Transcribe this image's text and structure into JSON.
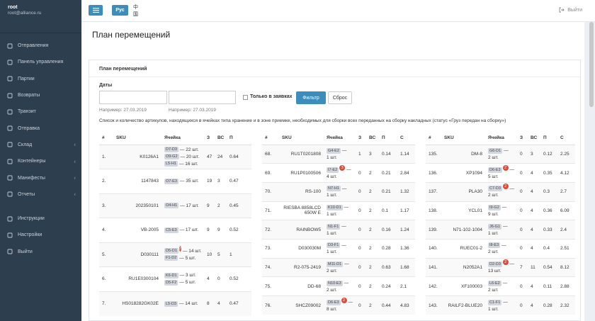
{
  "user": {
    "name": "root",
    "email": "root@alliance.ru"
  },
  "nav": [
    {
      "label": "Отправления",
      "icon": "paper-plane-icon",
      "chev": false
    },
    {
      "label": "Панель управления",
      "icon": "dashboard-icon",
      "chev": false
    },
    {
      "label": "Партии",
      "icon": "truck-icon",
      "chev": false
    },
    {
      "label": "Возвраты",
      "icon": "return-icon",
      "chev": false
    },
    {
      "label": "Транзит",
      "icon": "transit-icon",
      "chev": false
    },
    {
      "label": "Отправка",
      "icon": "send-icon",
      "chev": false
    },
    {
      "label": "Склад",
      "icon": "warehouse-icon",
      "chev": true
    },
    {
      "label": "Контейнеры",
      "icon": "container-icon",
      "chev": true
    },
    {
      "label": "Манифесты",
      "icon": "manifest-icon",
      "chev": true
    },
    {
      "label": "Отчеты",
      "icon": "reports-icon",
      "chev": true
    }
  ],
  "nav2": [
    {
      "label": "Инструкции",
      "icon": "info-icon"
    },
    {
      "label": "Настройки",
      "icon": "settings-icon"
    },
    {
      "label": "Выйти",
      "icon": "logout-icon"
    }
  ],
  "topbar": {
    "lang_ru": "Рус",
    "lang_cn": "中国",
    "logout": "Выйти"
  },
  "page": {
    "title": "План перемещений"
  },
  "box": {
    "title": "План перемещений",
    "dates_label": "Даты",
    "only_requests": "Только в заявках",
    "filter_btn": "Фильтр",
    "reset_btn": "Сброс",
    "hint1": "Например: 27.03.2019",
    "hint2": "Например: 27.03.2019",
    "desc": "Список и количество артикулов, находящихся в ячейках типа хранение и в зоне приемке, необходимых для сборки всех переданных на сборку накладных (статус «Груз передан на сборку»)"
  },
  "colors": {
    "accent": "#3c8dbc",
    "sidebar": "#2d3e4f",
    "badge": "#dd4b39"
  },
  "tables": [
    {
      "headers": [
        "#",
        "SKU",
        "Ячейка",
        "З",
        "ВС",
        "П"
      ],
      "rows": [
        {
          "n": "1.",
          "sku": "K0126A1",
          "cells": [
            {
              "tag": "D7-D3",
              "text": "— 22 шт."
            },
            {
              "tag": "O9-G2",
              "text": "— 20 шт."
            },
            {
              "tag": "L5-H1",
              "text": "— 16 шт."
            }
          ],
          "z": "47",
          "vs": "24",
          "p": "0.64"
        },
        {
          "n": "2.",
          "sku": "1147843",
          "cells": [
            {
              "tag": "O7-E3",
              "text": "— 35 шт."
            }
          ],
          "z": "19",
          "vs": "3",
          "p": "0.47"
        },
        {
          "n": "3.",
          "sku": "202350101",
          "cells": [
            {
              "tag": "O4-H1",
              "text": "— 17 шт."
            }
          ],
          "z": "9",
          "vs": "2",
          "p": "0.45"
        },
        {
          "n": "4.",
          "sku": "VB-2005",
          "cells": [
            {
              "tag": "C5-E3",
              "text": "— 17 шт."
            }
          ],
          "z": "9",
          "vs": "9",
          "p": "0.52"
        },
        {
          "n": "5.",
          "sku": "D030111",
          "cells": [
            {
              "tag": "D5-D1",
              "badge": "2",
              "text": "— 14 шт."
            },
            {
              "tag": "F1-D2",
              "text": "— 5 шт."
            }
          ],
          "z": "10",
          "vs": "5",
          "p": "1"
        },
        {
          "n": "6.",
          "sku": "RU1E0300104",
          "cells": [
            {
              "tag": "K6-D1",
              "text": "— 3 шт."
            },
            {
              "tag": "D5-F2",
              "text": "— 5 шт."
            }
          ],
          "z": "4",
          "vs": "0",
          "p": "0.52"
        },
        {
          "n": "7.",
          "sku": "HS018282GK02E",
          "cells": [
            {
              "tag": "L5-D3",
              "text": "— 14 шт."
            }
          ],
          "z": "8",
          "vs": "4",
          "p": "0.47"
        }
      ]
    },
    {
      "headers": [
        "#",
        "SKU",
        "Ячейка",
        "З",
        "ВС",
        "П",
        "С"
      ],
      "rows": [
        {
          "n": "68.",
          "sku": "RU1T0201808",
          "cells": [
            {
              "tag": "G4-E2",
              "text": "—"
            },
            {
              "text": "1 шт."
            }
          ],
          "z": "1",
          "vs": "3",
          "p": "0.14",
          "s": "1.14"
        },
        {
          "n": "69.",
          "sku": "RU1P0100506",
          "cells": [
            {
              "tag": "I7-E2",
              "badge": "3",
              "text": "—"
            },
            {
              "text": "4 шт."
            }
          ],
          "z": "0",
          "vs": "2",
          "p": "0.21",
          "s": "2.84"
        },
        {
          "n": "70.",
          "sku": "RS-100",
          "cells": [
            {
              "tag": "N7-H1",
              "text": "—"
            },
            {
              "text": "1 шт."
            }
          ],
          "z": "0",
          "vs": "2",
          "p": "0.21",
          "s": "1.32"
        },
        {
          "n": "71.",
          "sku": "RIESBA 8858LCD 650W E",
          "cells": [
            {
              "tag": "K10-D1",
              "text": "—"
            },
            {
              "text": "1 шт."
            }
          ],
          "z": "0",
          "vs": "2",
          "p": "0.1",
          "s": "1.17"
        },
        {
          "n": "72.",
          "sku": "RAINBOW5",
          "cells": [
            {
              "tag": "N1-F1",
              "text": "—"
            },
            {
              "text": "1 шт."
            }
          ],
          "z": "0",
          "vs": "2",
          "p": "0.16",
          "s": "1.24"
        },
        {
          "n": "73.",
          "sku": "D030030M",
          "cells": [
            {
              "tag": "D3-F1",
              "text": "—"
            },
            {
              "text": "1 шт."
            }
          ],
          "z": "0",
          "vs": "2",
          "p": "0.28",
          "s": "1.36"
        },
        {
          "n": "74.",
          "sku": "R2-075-2419",
          "cells": [
            {
              "tag": "M11-D1",
              "text": "—"
            },
            {
              "text": "2 шт."
            }
          ],
          "z": "0",
          "vs": "2",
          "p": "0.63",
          "s": "1.68"
        },
        {
          "n": "75.",
          "sku": "DD-68",
          "cells": [
            {
              "tag": "N10-E3",
              "text": "—"
            },
            {
              "text": "2 шт."
            }
          ],
          "z": "0",
          "vs": "2",
          "p": "0.24",
          "s": "2.1"
        },
        {
          "n": "76.",
          "sku": "SHCZ09002",
          "cells": [
            {
              "tag": "D6-E3",
              "badge": "2",
              "text": "—"
            },
            {
              "text": "8 шт."
            }
          ],
          "z": "0",
          "vs": "2",
          "p": "0.44",
          "s": "4.83"
        }
      ]
    },
    {
      "headers": [
        "#",
        "SKU",
        "Ячейка",
        "З",
        "ВС",
        "П",
        "С"
      ],
      "rows": [
        {
          "n": "135.",
          "sku": "DM-8",
          "cells": [
            {
              "tag": "G6-D1",
              "text": "—"
            },
            {
              "text": "2 шт."
            }
          ],
          "z": "0",
          "vs": "3",
          "p": "0.12",
          "s": "2.25"
        },
        {
          "n": "136.",
          "sku": "XP1094",
          "cells": [
            {
              "tag": "D6-E3",
              "badge": "2",
              "text": "—"
            },
            {
              "text": "5 шт."
            }
          ],
          "z": "0",
          "vs": "4",
          "p": "0.35",
          "s": "4.12"
        },
        {
          "n": "137.",
          "sku": "PLA30",
          "cells": [
            {
              "tag": "C7-D3",
              "badge": "2",
              "text": "—"
            },
            {
              "text": "2 шт."
            }
          ],
          "z": "0",
          "vs": "4",
          "p": "0.3",
          "s": "2.7"
        },
        {
          "n": "138.",
          "sku": "YCL01",
          "cells": [
            {
              "tag": "I9-G2",
              "text": "—"
            },
            {
              "text": "9 шт."
            }
          ],
          "z": "0",
          "vs": "4",
          "p": "0.36",
          "s": "6.09"
        },
        {
          "n": "139.",
          "sku": "N71-102-1004",
          "cells": [
            {
              "tag": "J6-G1",
              "text": "—"
            },
            {
              "text": "1 шт."
            }
          ],
          "z": "0",
          "vs": "4",
          "p": "0.33",
          "s": "2.4"
        },
        {
          "n": "140.",
          "sku": "RUEC01-2",
          "cells": [
            {
              "tag": "I8-E3",
              "text": "—"
            },
            {
              "text": "2 шт."
            }
          ],
          "z": "0",
          "vs": "4",
          "p": "0.4",
          "s": "2.51"
        },
        {
          "n": "141.",
          "sku": "N2052A1",
          "cells": [
            {
              "tag": "D2-D3",
              "badge": "2",
              "text": "—"
            },
            {
              "text": "13 шт."
            }
          ],
          "z": "7",
          "vs": "11",
          "p": "0.54",
          "s": "8.12"
        },
        {
          "n": "142.",
          "sku": "XF100003",
          "cells": [
            {
              "tag": "L6-E2",
              "text": "—"
            },
            {
              "text": "2 шт."
            }
          ],
          "z": "0",
          "vs": "4",
          "p": "0.11",
          "s": "2.88"
        },
        {
          "n": "143.",
          "sku": "RAILF2-BLUE20",
          "cells": [
            {
              "tag": "C1-F1",
              "text": "—"
            },
            {
              "text": "1 шт."
            }
          ],
          "z": "0",
          "vs": "4",
          "p": "0.28",
          "s": "2.32"
        }
      ]
    }
  ]
}
